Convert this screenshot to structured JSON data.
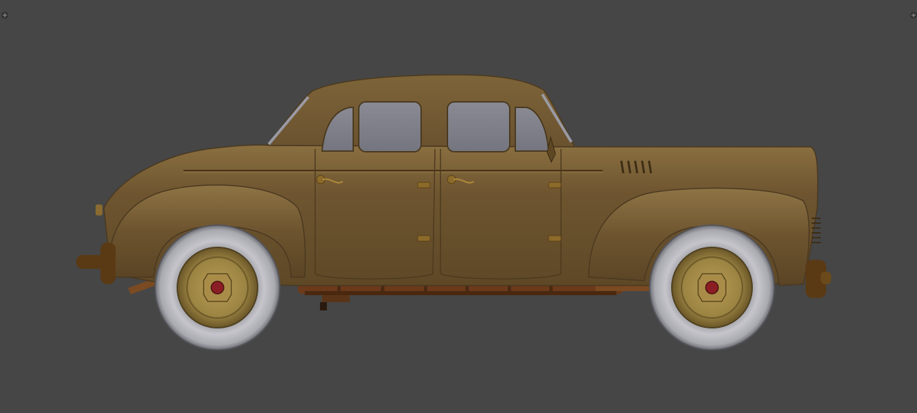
{
  "viewport": {
    "background_color": "#464646",
    "corner_widgets": [
      {
        "name": "area-split-left",
        "icon": "plus-icon"
      },
      {
        "name": "area-split-right",
        "icon": "plus-icon"
      }
    ]
  },
  "model": {
    "description_icon": "car-icon",
    "body_color": "#6b5430",
    "window_color": "#7b7b86",
    "tire_color": "#b9b9bf",
    "rim_color": "#9c8443",
    "hub_color": "#8b1e24",
    "chassis_color": "#6b3a1a"
  }
}
